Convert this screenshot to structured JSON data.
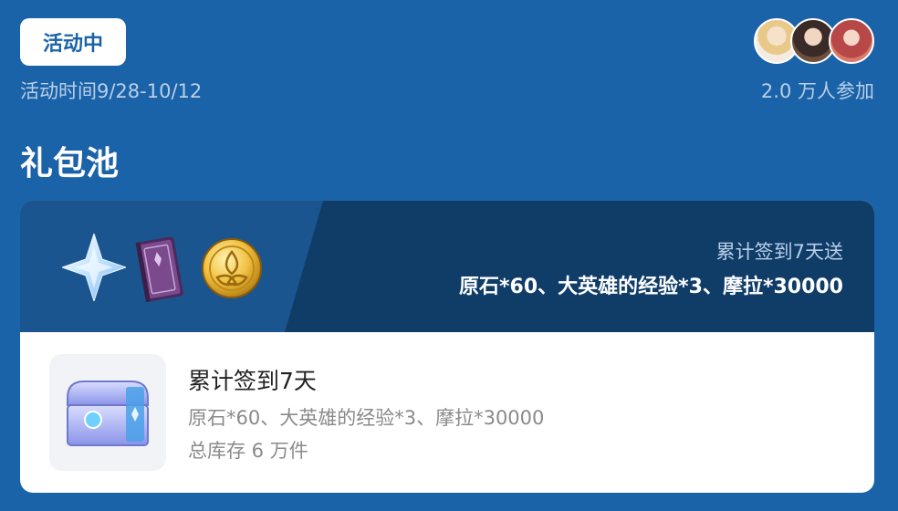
{
  "header": {
    "status_badge": "活动中",
    "event_time": "活动时间9/28-10/12",
    "participants": "2.0 万人参加"
  },
  "section": {
    "title": "礼包池"
  },
  "banner": {
    "caption": "累计签到7天送",
    "rewards": "原石*60、大英雄的经验*3、摩拉*30000",
    "icons": [
      "primogem-icon",
      "book-icon",
      "mora-icon"
    ]
  },
  "reward_item": {
    "title": "累计签到7天",
    "description": "原石*60、大英雄的经验*3、摩拉*30000",
    "stock": "总库存 6 万件",
    "icon": "chest-icon"
  },
  "colors": {
    "background": "#1b63a8",
    "banner_dark": "#103c68",
    "banner_light": "#1a5590",
    "muted_text": "#b9cfe8"
  }
}
